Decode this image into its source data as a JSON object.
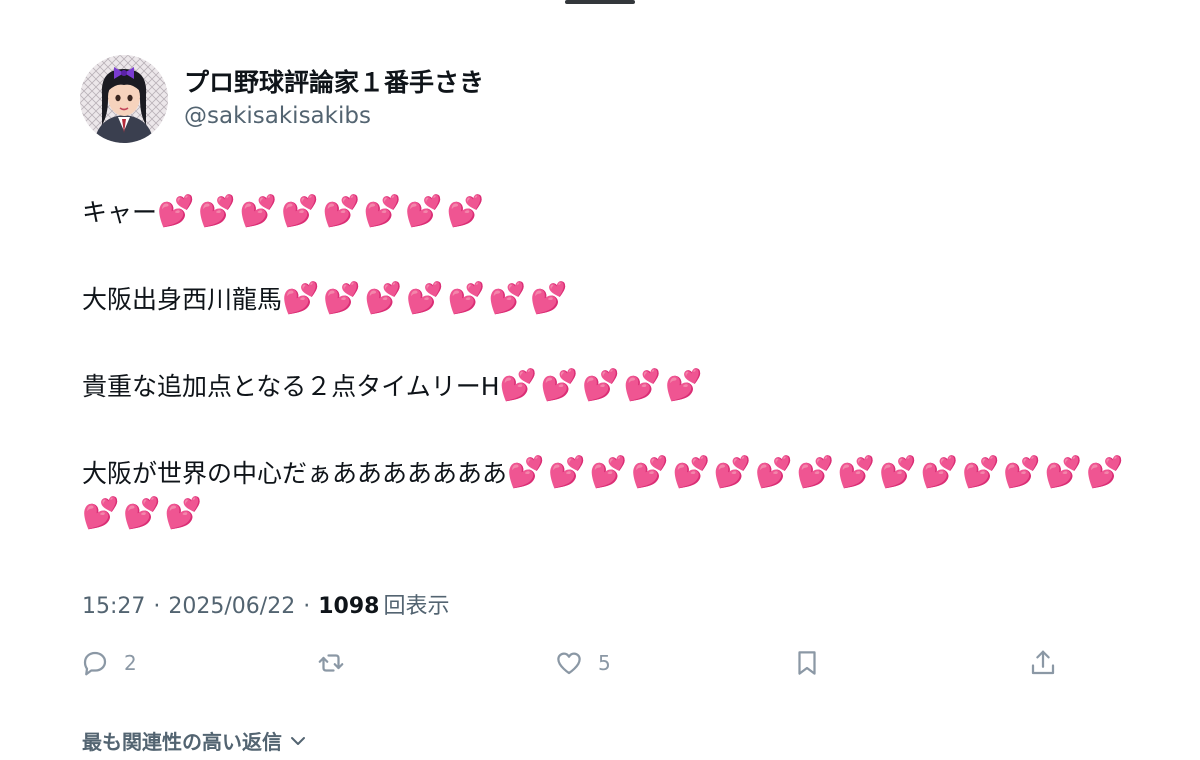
{
  "author": {
    "display_name": "プロ野球評論家１番手さき",
    "handle": "@sakisakisakibs"
  },
  "tweet": {
    "paragraphs": [
      {
        "text": "キャー",
        "hearts": 8
      },
      {
        "text": "大阪出身西川龍馬",
        "hearts": 7
      },
      {
        "text": "貴重な追加点となる２点タイムリーH",
        "hearts": 5
      },
      {
        "text": "大阪が世界の中心だぁあああああああ",
        "hearts": 18
      }
    ],
    "heart_emoji": "💕"
  },
  "meta": {
    "time": "15:27",
    "separator": "·",
    "date": "2025/06/22",
    "views_count": "1098",
    "views_label": "回表示"
  },
  "actions": {
    "reply_count": "2",
    "like_count": "5",
    "icon_color": "#8b98a5"
  },
  "replies_filter": {
    "label": "最も関連性の高い返信"
  },
  "colors": {
    "text_primary": "#0f1419",
    "text_secondary": "#536471",
    "heart": "#ff49c7"
  }
}
